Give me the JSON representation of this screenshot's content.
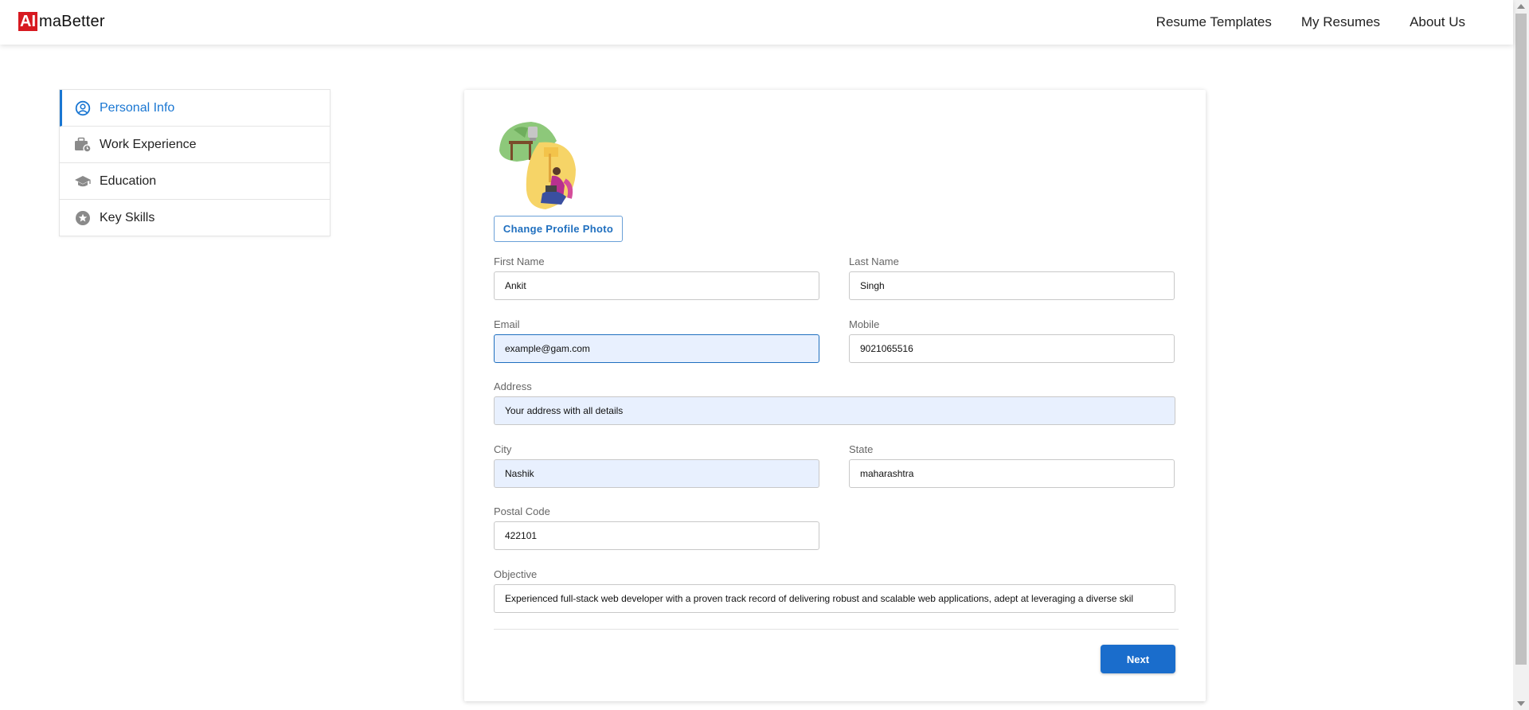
{
  "brand": {
    "mark": "AI",
    "text": "maBetter",
    "accent": "#d71920"
  },
  "nav": {
    "templates": "Resume Templates",
    "my_resumes": "My Resumes",
    "about": "About Us"
  },
  "sidebar": {
    "items": [
      {
        "label": "Personal Info",
        "icon": "user-circle-icon",
        "active": true
      },
      {
        "label": "Work Experience",
        "icon": "briefcase-icon",
        "active": false
      },
      {
        "label": "Education",
        "icon": "graduation-cap-icon",
        "active": false
      },
      {
        "label": "Key Skills",
        "icon": "star-icon",
        "active": false
      }
    ]
  },
  "form": {
    "change_photo": "Change Profile Photo",
    "first_name": {
      "label": "First Name",
      "value": "Ankit"
    },
    "last_name": {
      "label": "Last Name",
      "value": "Singh"
    },
    "email": {
      "label": "Email",
      "value": "example@gam.com"
    },
    "mobile": {
      "label": "Mobile",
      "value": "9021065516"
    },
    "address": {
      "label": "Address",
      "value": "Your address with all details"
    },
    "city": {
      "label": "City",
      "value": "Nashik"
    },
    "state": {
      "label": "State",
      "value": "maharashtra"
    },
    "postal": {
      "label": "Postal Code",
      "value": "422101"
    },
    "objective": {
      "label": "Objective",
      "value": "Experienced full-stack web developer with a proven track record of delivering robust and scalable web applications, adept at leveraging a diverse skil"
    },
    "next": "Next"
  },
  "colors": {
    "primary": "#1a6dcc",
    "autofill": "#e8f0fe"
  }
}
